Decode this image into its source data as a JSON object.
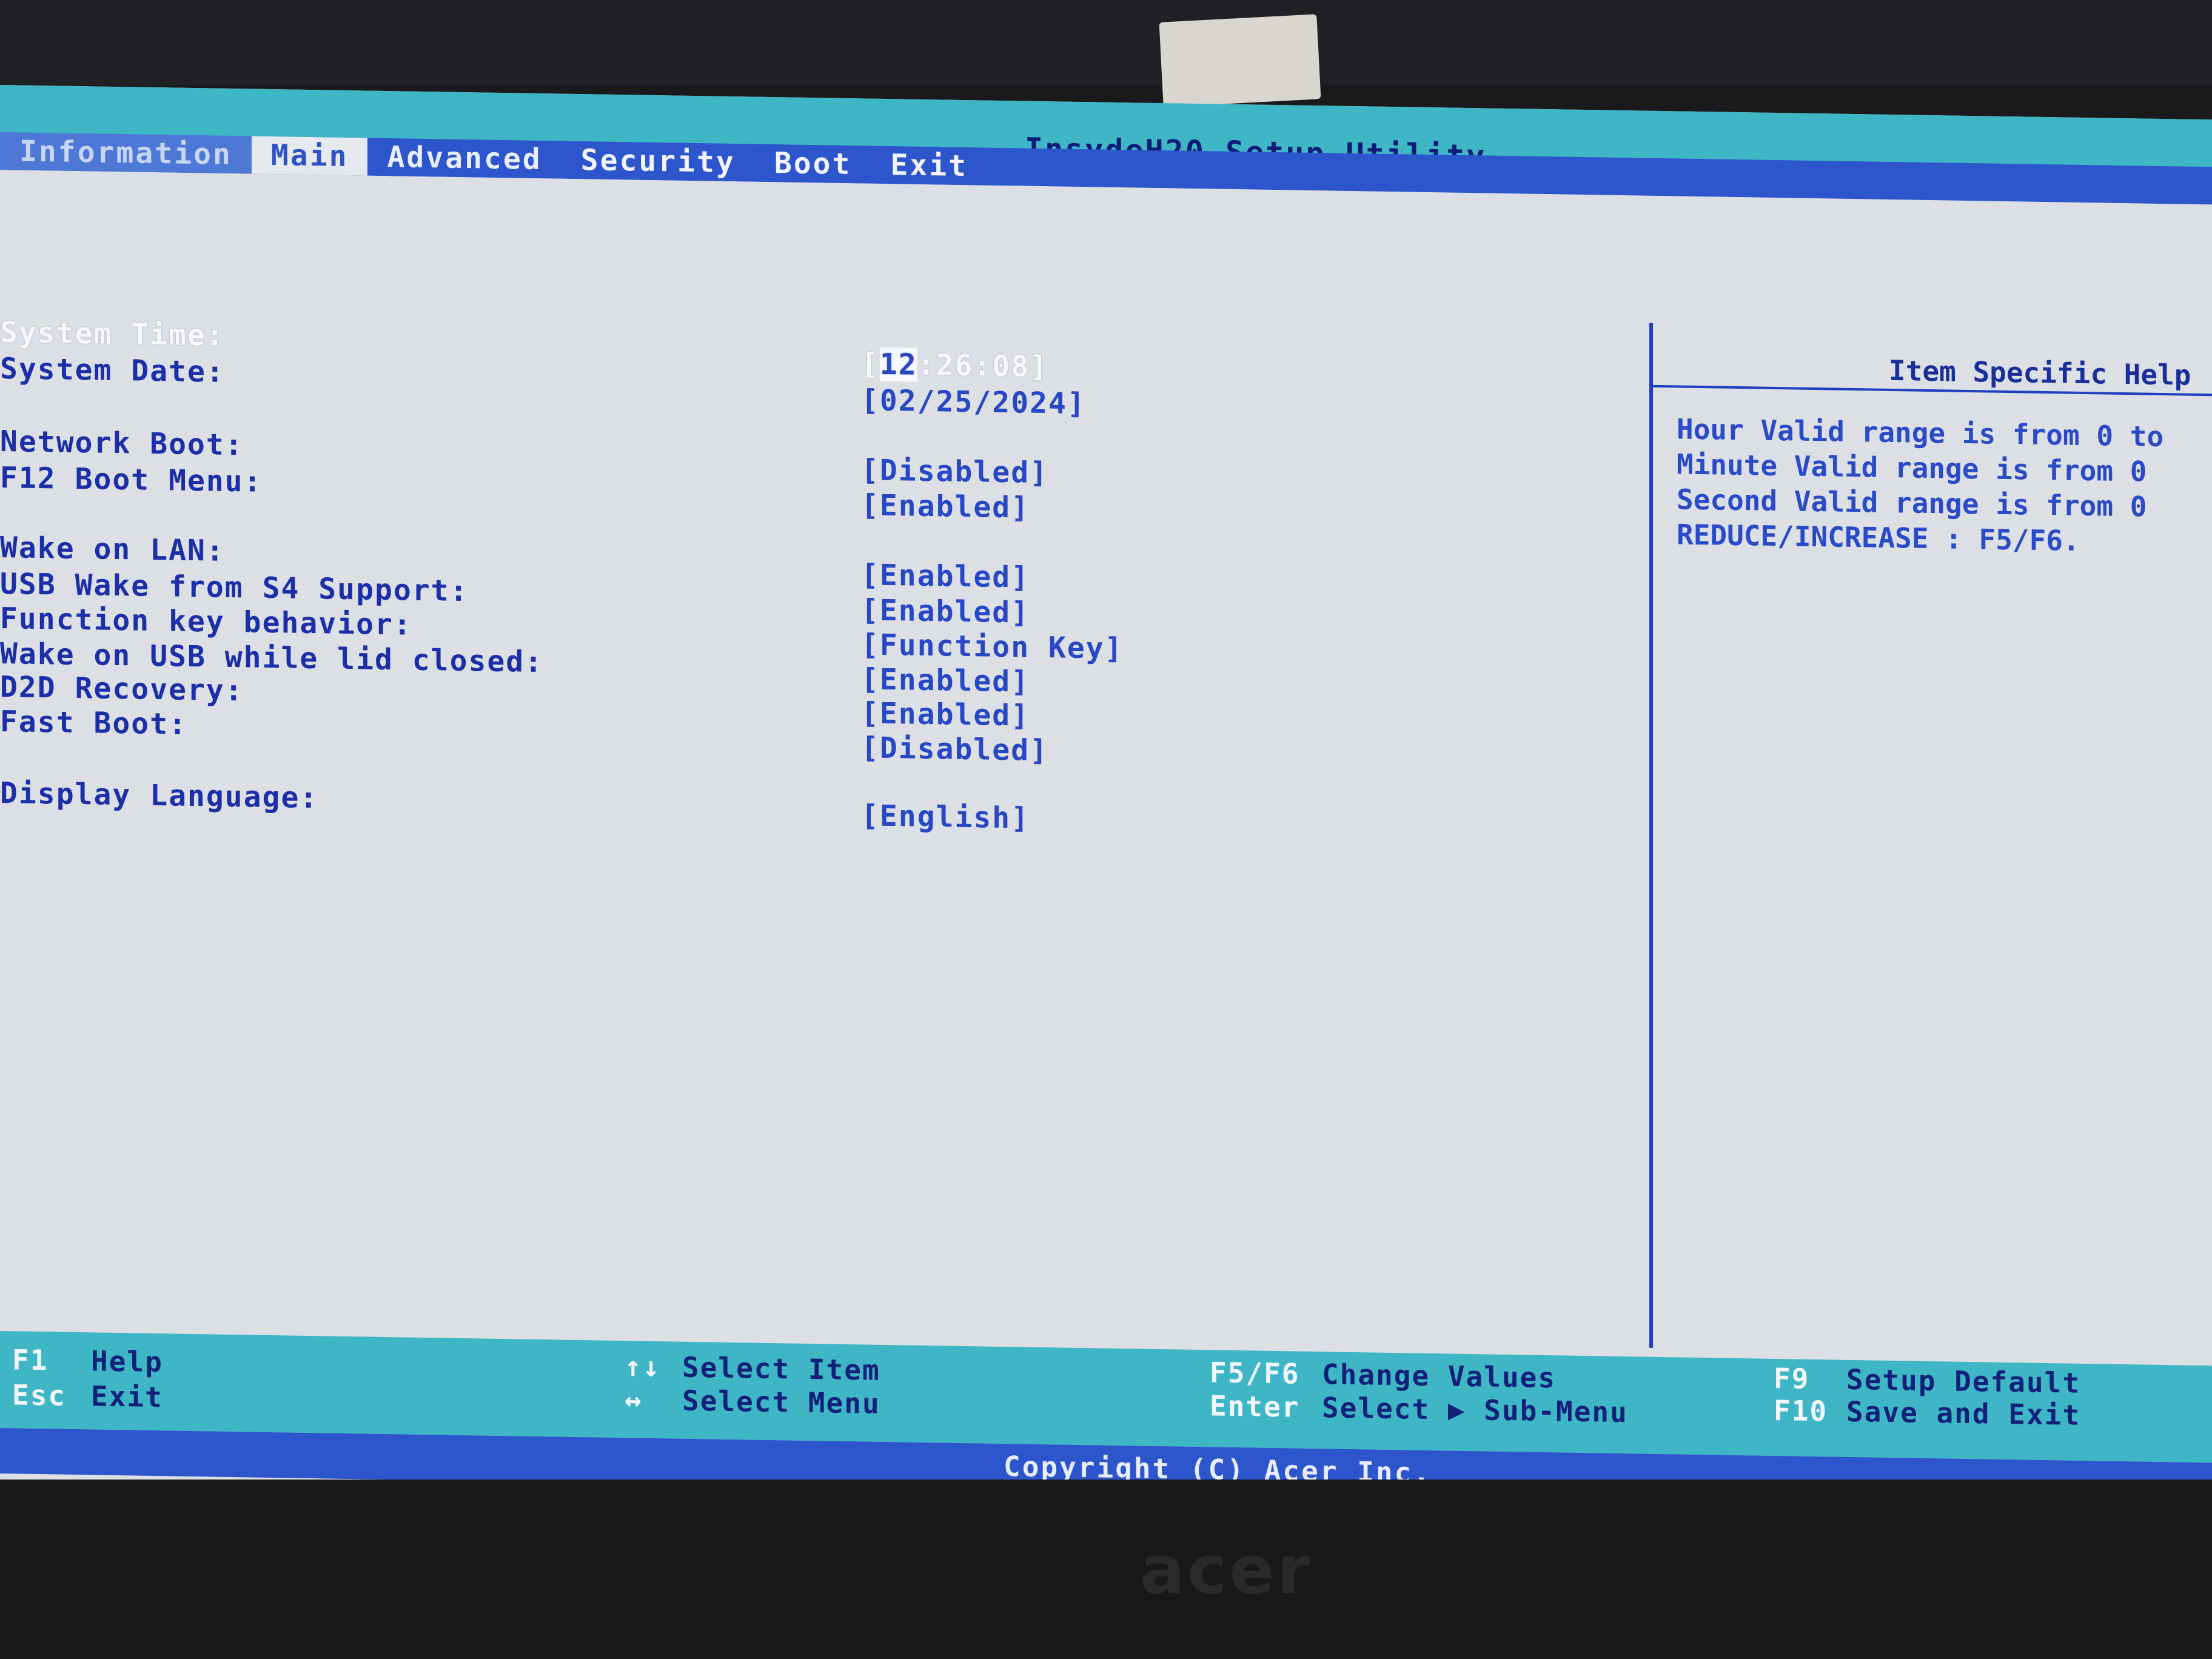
{
  "app_title": "InsydeH20 Setup Utility",
  "tabs": [
    {
      "label": "Information"
    },
    {
      "label": "Main"
    },
    {
      "label": "Advanced"
    },
    {
      "label": "Security"
    },
    {
      "label": "Boot"
    },
    {
      "label": "Exit"
    }
  ],
  "settings": [
    {
      "label": "System Time:",
      "value": "[12:26:08]",
      "value_head": "[",
      "value_selected": "12",
      "value_tail": ":26:08]"
    },
    {
      "label": "System Date:",
      "value": "[02/25/2024]"
    },
    {
      "label": "Network Boot:",
      "value": "[Disabled]"
    },
    {
      "label": "F12 Boot Menu:",
      "value": "[Enabled]"
    },
    {
      "label": "Wake on LAN:",
      "value": "[Enabled]"
    },
    {
      "label": "USB Wake from S4 Support:",
      "value": "[Enabled]"
    },
    {
      "label": "Function key behavior:",
      "value": "[Function Key]"
    },
    {
      "label": "Wake on USB while lid closed:",
      "value": "[Enabled]"
    },
    {
      "label": "D2D Recovery:",
      "value": "[Enabled]"
    },
    {
      "label": "Fast Boot:",
      "value": "[Disabled]"
    },
    {
      "label": "Display Language:",
      "value": "[English]"
    }
  ],
  "help_panel": {
    "title": "Item Specific Help",
    "lines": [
      "Hour Valid range is from 0 to",
      "Minute Valid range is from 0",
      "Second Valid range is from 0",
      "REDUCE/INCREASE : F5/F6."
    ]
  },
  "footer": {
    "f1_key": "F1",
    "f1_desc": "Help",
    "esc_key": "Esc",
    "esc_desc": "Exit",
    "updown_key": "↑↓",
    "updown_desc": "Select Item",
    "leftright_key": "↔",
    "leftright_desc": "Select Menu",
    "f5f6_key": "F5/F6",
    "f5f6_desc": "Change Values",
    "enter_key": "Enter",
    "enter_desc": "Select ▶ Sub-Menu",
    "f9_key": "F9",
    "f9_desc": "Setup Default",
    "f10_key": "F10",
    "f10_desc": "Save and Exit",
    "copyright": "Copyright (C) Acer Inc."
  },
  "bezel_logo": "acer",
  "colors": {
    "header_cyan": "#3fb6c6",
    "tab_blue": "#2e56cc",
    "body_bg": "#dcdfe4",
    "text_blue": "#1c2ea8"
  }
}
